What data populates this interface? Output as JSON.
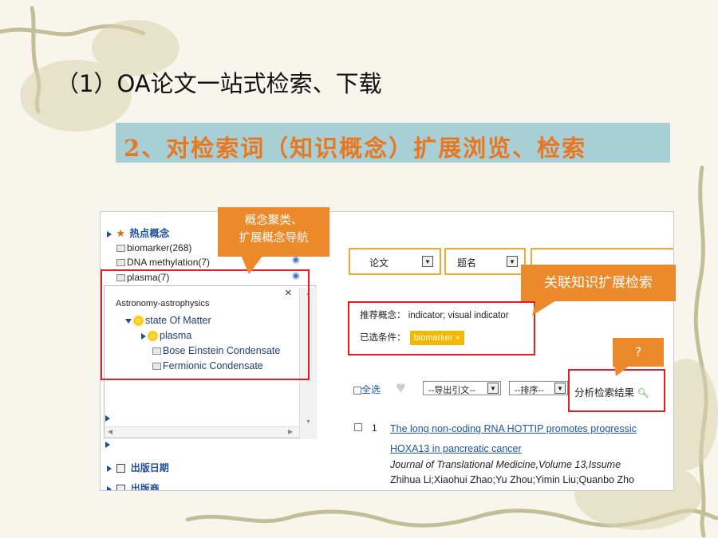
{
  "slide": {
    "heading": "（1）OA论文一站式检索、下载",
    "banner": "2、对检索词（知识概念）扩展浏览、检索"
  },
  "left_panel": {
    "hot_concepts_label": "热点概念",
    "concept_items": [
      {
        "label": "biomarker(268)"
      },
      {
        "label": "DNA methylation(7)"
      },
      {
        "label": "plasma(7)"
      }
    ],
    "popup": {
      "category": "Astronomy-astrophysics",
      "close": "×",
      "tree_root": "state Of Matter",
      "tree_child": "plasma",
      "tree_leaf_1": "Bose Einstein Condensate",
      "tree_leaf_2": "Fermionic Condensate"
    },
    "pub_date_label": "出版日期",
    "publisher_label": "出版商"
  },
  "search": {
    "type_select": "论文",
    "field_select": "题名",
    "recommend_label": "推荐概念：",
    "recommend_values": "indicator;  visual indicator",
    "selected_label": "已选条件：",
    "selected_tag": "biomarker",
    "selected_tag_close": "×"
  },
  "toolbar": {
    "select_all": "全选",
    "export_select": "--导出引文--",
    "sort_select": "--排序--",
    "analyze": "分析检索结果"
  },
  "result": {
    "index": "1",
    "title_line1": "The long non-coding RNA HOTTIP promotes progressic",
    "title_line2": "HOXA13 in pancreatic cancer",
    "journal": "Journal of Translational Medicine,Volume 13,Issume",
    "authors": "Zhihua Li;Xiaohui Zhao;Yu Zhou;Yimin Liu;Quanbo Zho"
  },
  "callouts": {
    "concept_cluster": "概念聚类、\n扩展概念导航",
    "related_search": "关联知识扩展检索",
    "question": "?"
  },
  "colors": {
    "callout": "#ec8a2b",
    "highlight_red": "#e02020",
    "banner_bg": "#a9cfd6",
    "banner_text": "#e8771e",
    "link": "#1a55b0"
  }
}
